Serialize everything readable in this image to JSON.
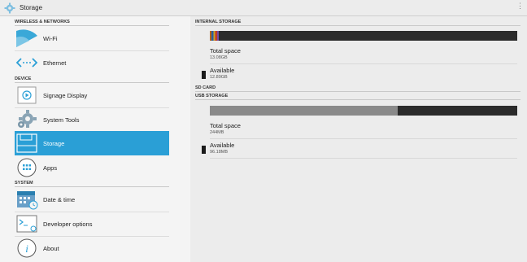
{
  "titlebar": {
    "title": "Storage",
    "overflow_icon": "more-vert-icon"
  },
  "sidebar": {
    "sections": [
      {
        "header": "WIRELESS & NETWORKS"
      },
      {
        "header": "DEVICE"
      },
      {
        "header": "SYSTEM"
      }
    ],
    "items": [
      {
        "label": "Wi-Fi",
        "icon": "wifi-icon"
      },
      {
        "label": "Ethernet",
        "icon": "ethernet-icon"
      },
      {
        "label": "Signage Display",
        "icon": "signage-display-icon"
      },
      {
        "label": "System Tools",
        "icon": "gear-icon"
      },
      {
        "label": "Storage",
        "icon": "storage-icon",
        "selected": true
      },
      {
        "label": "Apps",
        "icon": "apps-icon"
      },
      {
        "label": "Date & time",
        "icon": "calendar-icon"
      },
      {
        "label": "Developer options",
        "icon": "terminal-icon"
      },
      {
        "label": "About",
        "icon": "info-icon"
      }
    ],
    "accent": "#2a9fd6"
  },
  "internal_storage": {
    "title": "INTERNAL STORAGE",
    "usage_fraction": 0.03,
    "total_label": "Total space",
    "total_value": "13.08GB",
    "available_label": "Available",
    "available_value": "12.89GB"
  },
  "sd_card": {
    "title": "SD CARD"
  },
  "usb_storage": {
    "title": "USB STORAGE",
    "usage_fraction": 0.61,
    "total_label": "Total space",
    "total_value": "244MB",
    "available_label": "Available",
    "available_value": "96.18MB"
  }
}
